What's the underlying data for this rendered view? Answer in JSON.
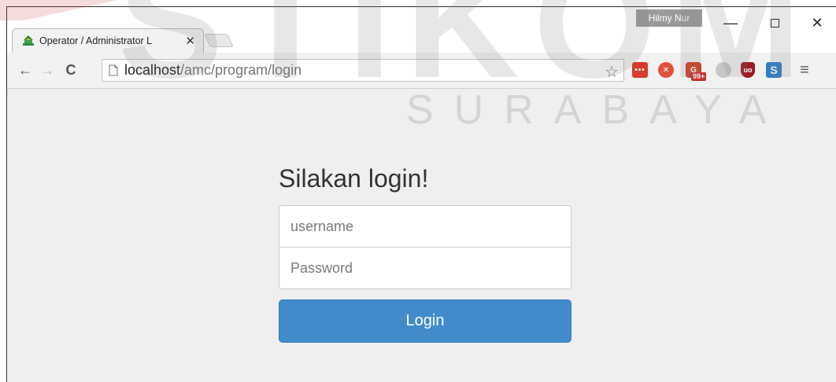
{
  "watermark": {
    "title": "STIKOM",
    "subtitle": "SURABAYA"
  },
  "window": {
    "profile_name": "Hilmy Nur",
    "controls": {
      "minimize": "—",
      "maximize": "☐",
      "close": "✕"
    }
  },
  "tab": {
    "title": "Operator / Administrator L",
    "close": "✕"
  },
  "toolbar": {
    "back": "←",
    "forward": "→",
    "reload": "C",
    "url_host": "localhost",
    "url_path": "/amc/program/login",
    "star": "☆",
    "extensions": [
      {
        "name": "dots-extension",
        "label": "•••"
      },
      {
        "name": "rocket-extension",
        "label": "✕"
      },
      {
        "name": "g-extension",
        "label": "G",
        "badge": "99+"
      },
      {
        "name": "globe-extension",
        "label": ""
      },
      {
        "name": "ublock-extension",
        "label": "uo"
      },
      {
        "name": "s-extension",
        "label": "S"
      }
    ],
    "menu": "≡"
  },
  "login": {
    "heading": "Silakan login!",
    "username_placeholder": "username",
    "password_placeholder": "Password",
    "button_label": "Login"
  },
  "colors": {
    "primary_button": "#428bca",
    "page_background": "#efefef"
  }
}
